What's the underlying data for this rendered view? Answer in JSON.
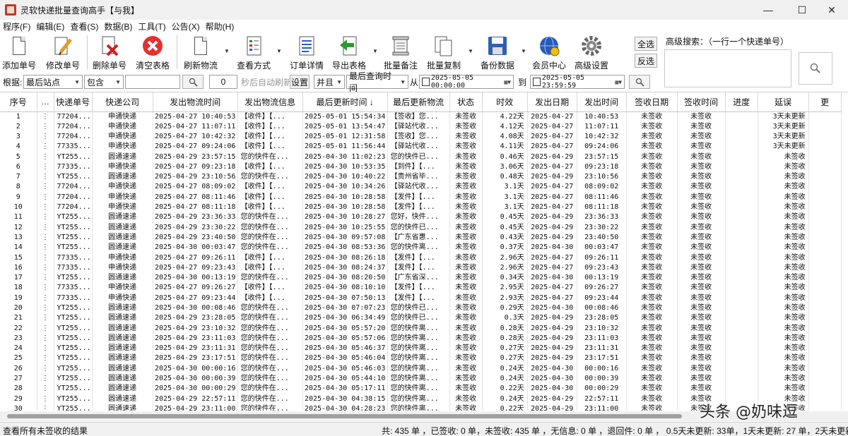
{
  "window": {
    "title": "灵软快递批量查询高手【与我】"
  },
  "menu": [
    "程序(F)",
    "编辑(E)",
    "查看(S)",
    "数据(B)",
    "工具(T)",
    "公告(X)",
    "帮助(H)"
  ],
  "toolbar": {
    "add": "添加单号",
    "edit": "修改单号",
    "delete": "删除单号",
    "clear": "清空表格",
    "refresh": "刷新物流",
    "view_mode": "查看方式",
    "order_detail": "订单详情",
    "export": "导出表格",
    "batch_note": "批量备注",
    "batch_copy": "批量复制",
    "backup": "备份数据",
    "member": "会员中心",
    "advanced": "高级设置",
    "select_all": "全选",
    "invert": "反选",
    "adv_search_label": "高级搜索：（一行一个快递单号）"
  },
  "filter": {
    "basis_label": "根据:",
    "basis_value": "最后站点",
    "contains_value": "包含",
    "interval_value": "0",
    "auto_refresh_label": "秒后自动刷新",
    "setting_btn": "设置",
    "logic_value": "并且",
    "time_field_value": "最后查询时间",
    "from_label": "从",
    "from_value": "2025-05-05 00:00:00",
    "to_label": "到",
    "to_value": "2025-05-05 23:59:59"
  },
  "table": {
    "headers": [
      "序号",
      "…",
      "快递单号",
      "快递公司",
      "发出物流时间",
      "发出物流信息",
      "最后更新时间 ↓",
      "最后更新物流",
      "状态",
      "时效",
      "发出日期",
      "发出时间",
      "签收日期",
      "签收时间",
      "进度",
      "延误",
      "更"
    ],
    "rows": [
      [
        "1",
        "⋮",
        "77204...",
        "申通快递",
        "2025-04-27 10:40:53",
        "【收件】【...",
        "2025-05-01 15:54:34",
        "【签收】您...",
        "未签收",
        "4.22天",
        "2025-04-27",
        "10:40:53",
        "未签收",
        "未签收",
        "",
        "3天未更新"
      ],
      [
        "2",
        "⋮",
        "77204...",
        "申通快递",
        "2025-04-27 11:07:11",
        "【收件】【...",
        "2025-05-01 13:54:47",
        "【驿站代收...",
        "未签收",
        "4.12天",
        "2025-04-27",
        "11:07:11",
        "未签收",
        "未签收",
        "",
        "3天未更新"
      ],
      [
        "3",
        "⋮",
        "77204...",
        "申通快递",
        "2025-04-27 10:42:32",
        "【收件】【...",
        "2025-05-01 12:31:58",
        "【签收】您...",
        "未签收",
        "4.08天",
        "2025-04-27",
        "10:42:32",
        "未签收",
        "未签收",
        "",
        "3天未更新"
      ],
      [
        "4",
        "⋮",
        "77335...",
        "申通快递",
        "2025-04-27 09:24:06",
        "【收件】【...",
        "2025-05-01 11:56:44",
        "【驿站代收...",
        "未签收",
        "4.11天",
        "2025-04-27",
        "09:24:06",
        "未签收",
        "未签收",
        "",
        "3天未更新"
      ],
      [
        "5",
        "⋮",
        "YT255...",
        "圆通速递",
        "2025-04-29 23:57:15",
        "您的快件在...",
        "2025-04-30 11:02:23",
        "您的快件已...",
        "未签收",
        "0.46天",
        "2025-04-29",
        "23:57:15",
        "未签收",
        "未签收",
        "",
        "未签收"
      ],
      [
        "6",
        "⋮",
        "77335...",
        "申通快递",
        "2025-04-27 09:23:18",
        "【收件】【...",
        "2025-04-30 10:53:35",
        "【到件】【...",
        "未签收",
        "3.06天",
        "2025-04-27",
        "09:23:18",
        "未签收",
        "未签收",
        "",
        "未签收"
      ],
      [
        "7",
        "⋮",
        "YT255...",
        "圆通速递",
        "2025-04-29 23:10:56",
        "您的快件在...",
        "2025-04-30 10:40:22",
        "【贵州省毕...",
        "未签收",
        "0.48天",
        "2025-04-29",
        "23:10:56",
        "未签收",
        "未签收",
        "",
        "未签收"
      ],
      [
        "8",
        "⋮",
        "77204...",
        "申通快递",
        "2025-04-27 08:09:02",
        "【收件】【...",
        "2025-04-30 10:34:26",
        "【驿站代收...",
        "未签收",
        "3.1天",
        "2025-04-27",
        "08:09:02",
        "未签收",
        "未签收",
        "",
        "未签收"
      ],
      [
        "9",
        "⋮",
        "77204...",
        "申通快递",
        "2025-04-27 08:11:46",
        "【收件】【...",
        "2025-04-30 10:28:58",
        "【发件】【...",
        "未签收",
        "3.1天",
        "2025-04-27",
        "08:11:46",
        "未签收",
        "未签收",
        "",
        "未签收"
      ],
      [
        "10",
        "⋮",
        "77204...",
        "申通快递",
        "2025-04-27 08:11:18",
        "【收件】【...",
        "2025-04-30 10:28:58",
        "【发件】【...",
        "未签收",
        "3.1天",
        "2025-04-27",
        "08:11:18",
        "未签收",
        "未签收",
        "",
        "未签收"
      ],
      [
        "11",
        "⋮",
        "YT255...",
        "圆通速递",
        "2025-04-29 23:36:33",
        "您的快件在...",
        "2025-04-30 10:28:27",
        "您好，快件...",
        "未签收",
        "0.45天",
        "2025-04-29",
        "23:36:33",
        "未签收",
        "未签收",
        "",
        "未签收"
      ],
      [
        "12",
        "⋮",
        "YT255...",
        "圆通速递",
        "2025-04-29 23:30:22",
        "您的快件在...",
        "2025-04-30 10:25:55",
        "您的快件已...",
        "未签收",
        "0.45天",
        "2025-04-29",
        "23:30:22",
        "未签收",
        "未签收",
        "",
        "未签收"
      ],
      [
        "13",
        "⋮",
        "YT255...",
        "圆通速递",
        "2025-04-29 23:40:50",
        "您的快件在...",
        "2025-04-30 09:57:08",
        "【广东省惠...",
        "未签收",
        "0.43天",
        "2025-04-29",
        "23:40:50",
        "未签收",
        "未签收",
        "",
        "未签收"
      ],
      [
        "14",
        "⋮",
        "YT255...",
        "圆通速递",
        "2025-04-30 00:03:47",
        "您的快件在...",
        "2025-04-30 08:53:36",
        "您的快件离...",
        "未签收",
        "0.37天",
        "2025-04-30",
        "00:03:47",
        "未签收",
        "未签收",
        "",
        "未签收"
      ],
      [
        "15",
        "⋮",
        "77335...",
        "申通快递",
        "2025-04-27 09:26:11",
        "【收件】【...",
        "2025-04-30 08:26:18",
        "【发件】【...",
        "未签收",
        "2.96天",
        "2025-04-27",
        "09:26:11",
        "未签收",
        "未签收",
        "",
        "未签收"
      ],
      [
        "16",
        "⋮",
        "77335...",
        "申通快递",
        "2025-04-27 09:23:43",
        "【收件】【...",
        "2025-04-30 08:24:37",
        "【发件】【...",
        "未签收",
        "2.96天",
        "2025-04-27",
        "09:23:43",
        "未签收",
        "未签收",
        "",
        "未签收"
      ],
      [
        "17",
        "⋮",
        "YT255...",
        "圆通速递",
        "2025-04-30 00:13:19",
        "您的快件在...",
        "2025-04-30 08:20:50",
        "【广东省深...",
        "未签收",
        "0.34天",
        "2025-04-30",
        "00:13:19",
        "未签收",
        "未签收",
        "",
        "未签收"
      ],
      [
        "18",
        "⋮",
        "77335...",
        "申通快递",
        "2025-04-27 09:26:27",
        "【收件】【...",
        "2025-04-30 08:10:10",
        "【发件】【...",
        "未签收",
        "2.95天",
        "2025-04-27",
        "09:26:27",
        "未签收",
        "未签收",
        "",
        "未签收"
      ],
      [
        "19",
        "⋮",
        "77335...",
        "申通快递",
        "2025-04-27 09:23:44",
        "【收件】【...",
        "2025-04-30 07:50:13",
        "【发件】【...",
        "未签收",
        "2.93天",
        "2025-04-27",
        "09:23:44",
        "未签收",
        "未签收",
        "",
        "未签收"
      ],
      [
        "20",
        "⋮",
        "YT255...",
        "圆通速递",
        "2025-04-30 00:08:46",
        "您的快件在...",
        "2025-04-30 07:07:23",
        "您的快件已...",
        "未签收",
        "0.29天",
        "2025-04-30",
        "00:08:46",
        "未签收",
        "未签收",
        "",
        "未签收"
      ],
      [
        "21",
        "⋮",
        "YT255...",
        "圆通速递",
        "2025-04-29 23:28:05",
        "您的快件在...",
        "2025-04-30 06:34:49",
        "您的快件已...",
        "未签收",
        "0.3天",
        "2025-04-29",
        "23:28:05",
        "未签收",
        "未签收",
        "",
        "未签收"
      ],
      [
        "22",
        "⋮",
        "YT255...",
        "圆通速递",
        "2025-04-29 23:10:32",
        "您的快件在...",
        "2025-04-30 05:57:20",
        "您的快件离...",
        "未签收",
        "0.28天",
        "2025-04-29",
        "23:10:32",
        "未签收",
        "未签收",
        "",
        "未签收"
      ],
      [
        "23",
        "⋮",
        "YT255...",
        "圆通速递",
        "2025-04-29 23:11:03",
        "您的快件在...",
        "2025-04-30 05:57:06",
        "您的快件离...",
        "未签收",
        "0.28天",
        "2025-04-29",
        "23:11:03",
        "未签收",
        "未签收",
        "",
        "未签收"
      ],
      [
        "24",
        "⋮",
        "YT255...",
        "圆通速递",
        "2025-04-29 23:11:31",
        "您的快件在...",
        "2025-04-30 05:46:37",
        "您的快件离...",
        "未签收",
        "0.27天",
        "2025-04-29",
        "23:11:31",
        "未签收",
        "未签收",
        "",
        "未签收"
      ],
      [
        "25",
        "⋮",
        "YT255...",
        "圆通速递",
        "2025-04-29 23:17:51",
        "您的快件在...",
        "2025-04-30 05:46:04",
        "您的快件离...",
        "未签收",
        "0.27天",
        "2025-04-29",
        "23:17:51",
        "未签收",
        "未签收",
        "",
        "未签收"
      ],
      [
        "26",
        "⋮",
        "YT255...",
        "圆通速递",
        "2025-04-30 00:00:16",
        "您的快件在...",
        "2025-04-30 05:46:03",
        "您的快件离...",
        "未签收",
        "0.24天",
        "2025-04-30",
        "00:00:16",
        "未签收",
        "未签收",
        "",
        "未签收"
      ],
      [
        "27",
        "⋮",
        "YT255...",
        "圆通速递",
        "2025-04-30 00:00:39",
        "您的快件在...",
        "2025-04-30 05:44:10",
        "您的快件离...",
        "未签收",
        "0.24天",
        "2025-04-30",
        "00:00:39",
        "未签收",
        "未签收",
        "",
        "未签收"
      ],
      [
        "28",
        "⋮",
        "YT255...",
        "圆通速递",
        "2025-04-30 00:00:29",
        "您的快件在...",
        "2025-04-30 05:17:11",
        "您的快件离...",
        "未签收",
        "0.22天",
        "2025-04-30",
        "00:00:29",
        "未签收",
        "未签收",
        "",
        "未签收"
      ],
      [
        "29",
        "⋮",
        "YT255...",
        "圆通速递",
        "2025-04-29 22:57:11",
        "您的快件在...",
        "2025-04-30 04:38:15",
        "您的快件离...",
        "未签收",
        "0.24天",
        "2025-04-29",
        "22:57:11",
        "未签收",
        "未签收",
        "",
        "未签收"
      ],
      [
        "30",
        "⋮",
        "YT255...",
        "圆通速递",
        "2025-04-29 23:11:00",
        "您的快件在...",
        "2025-04-30 04:28:23",
        "您的快件离...",
        "未签收",
        "0.22天",
        "2025-04-29",
        "23:11:00",
        "未签收",
        "未签收",
        "",
        "未签收"
      ]
    ]
  },
  "status": {
    "left": "查看所有未签收的结果",
    "right": "共: 435 单 ，已签收: 0 单，未签收: 435 单 ，无信息: 0 单 ，退回件: 0 单 ，  0.5天未更新: 33单，1天未更新: 27 单，2天未更新"
  },
  "watermark": "头条 @奶味逗"
}
